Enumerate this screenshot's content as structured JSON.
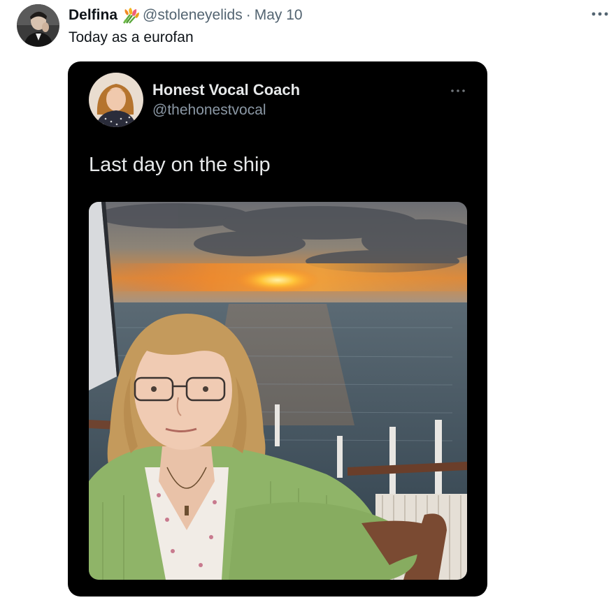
{
  "post": {
    "author_name": "Delfina",
    "author_emoji_icon": "tulip-bouquet-icon",
    "author_handle": "@stoleneyelids",
    "separator": "·",
    "date": "May 10",
    "text": "Today as a eurofan",
    "more_icon": "more-horizontal-icon"
  },
  "embedded_post": {
    "author_name": "Honest Vocal Coach",
    "author_handle": "@thehonestvocal",
    "text": "Last day on the ship",
    "more_icon": "more-horizontal-icon",
    "photo_description_icon": "sunset-sea-selfie-photo"
  },
  "colors": {
    "text_primary": "#0f1419",
    "text_secondary": "#536471",
    "card_background": "#000000",
    "card_text": "#e7e9ea",
    "card_text_secondary": "#8b98a5"
  }
}
